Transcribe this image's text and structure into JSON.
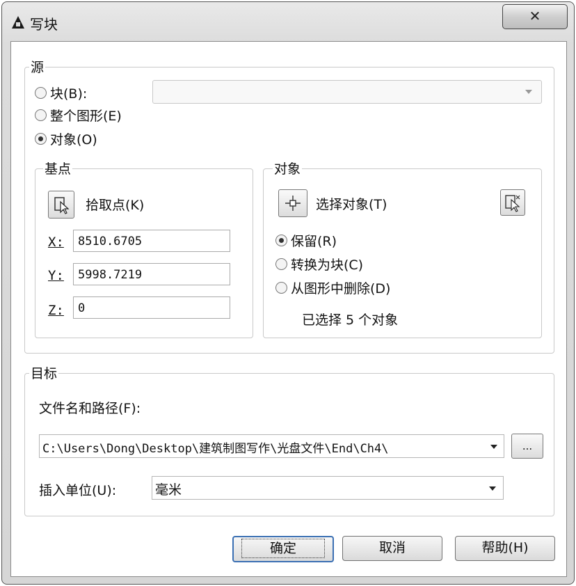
{
  "window": {
    "title": "写块",
    "close_icon": "close-icon"
  },
  "source": {
    "legend": "源",
    "block_radio": "块(B):",
    "entire_drawing_radio": "整个图形(E)",
    "objects_radio": "对象(O)",
    "selected": "objects",
    "block_combo_value": ""
  },
  "base_point": {
    "legend": "基点",
    "pick_label": "拾取点(K)",
    "x_label": "X:",
    "x_value": "8510.6705",
    "y_label": "Y:",
    "y_value": "5998.7219",
    "z_label": "Z:",
    "z_value": "0"
  },
  "objects": {
    "legend": "对象",
    "select_label": "选择对象(T)",
    "retain_radio": "保留(R)",
    "convert_radio": "转换为块(C)",
    "delete_radio": "从图形中删除(D)",
    "selected": "retain",
    "status": "已选择 5 个对象"
  },
  "destination": {
    "legend": "目标",
    "file_label": "文件名和路径(F):",
    "file_path": "C:\\Users\\Dong\\Desktop\\建筑制图写作\\光盘文件\\End\\Ch4\\",
    "browse_label": "...",
    "units_label": "插入单位(U):",
    "units_value": "毫米"
  },
  "buttons": {
    "ok": "确定",
    "cancel": "取消",
    "help": "帮助(H)"
  }
}
